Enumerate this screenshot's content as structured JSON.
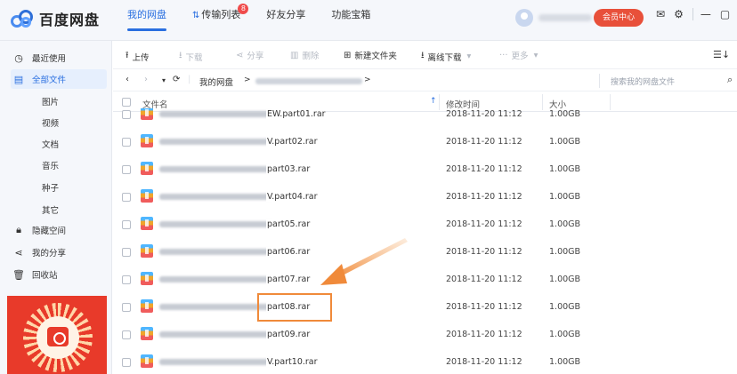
{
  "app": {
    "name": "百度网盘"
  },
  "topnav": {
    "items": [
      {
        "label": "我的网盘",
        "active": true
      },
      {
        "label": "传输列表",
        "badge": "8"
      },
      {
        "label": "好友分享"
      },
      {
        "label": "功能宝箱"
      }
    ]
  },
  "user": {
    "vip_label": "会员中心"
  },
  "sidebar": {
    "items": [
      {
        "label": "最近使用",
        "icon": "clock-icon"
      },
      {
        "label": "全部文件",
        "icon": "file-icon",
        "active": true
      }
    ],
    "subitems": [
      "图片",
      "视频",
      "文档",
      "音乐",
      "种子",
      "其它"
    ],
    "items2": [
      {
        "label": "隐藏空间",
        "icon": "lock-icon"
      },
      {
        "label": "我的分享",
        "icon": "share-icon"
      },
      {
        "label": "回收站",
        "icon": "trash-icon"
      }
    ]
  },
  "toolbar": {
    "upload": "上传",
    "download": "下载",
    "share": "分享",
    "delete": "删除",
    "new_folder": "新建文件夹",
    "offline": "离线下载",
    "more": "更多"
  },
  "breadcrumb": {
    "root": "我的网盘",
    "sep": ">",
    "search_placeholder": "搜索我的网盘文件"
  },
  "columns": {
    "name": "文件名",
    "modified": "修改时间",
    "size": "大小"
  },
  "files": [
    {
      "suffix": "EW.part01.rar",
      "date": "2018-11-20 11:12",
      "size": "1.00GB"
    },
    {
      "suffix": "V.part02.rar",
      "date": "2018-11-20 11:12",
      "size": "1.00GB"
    },
    {
      "suffix": "part03.rar",
      "date": "2018-11-20 11:12",
      "size": "1.00GB"
    },
    {
      "suffix": "V.part04.rar",
      "date": "2018-11-20 11:12",
      "size": "1.00GB"
    },
    {
      "suffix": "part05.rar",
      "date": "2018-11-20 11:12",
      "size": "1.00GB"
    },
    {
      "suffix": "part06.rar",
      "date": "2018-11-20 11:12",
      "size": "1.00GB"
    },
    {
      "suffix": "part07.rar",
      "date": "2018-11-20 11:12",
      "size": "1.00GB"
    },
    {
      "suffix": "part08.rar",
      "date": "2018-11-20 11:12",
      "size": "1.00GB",
      "highlighted": true
    },
    {
      "suffix": "part09.rar",
      "date": "2018-11-20 11:12",
      "size": "1.00GB"
    },
    {
      "suffix": "V.part10.rar",
      "date": "2018-11-20 11:12",
      "size": "1.00GB"
    }
  ],
  "colors": {
    "accent": "#2a6fe0",
    "vip": "#e8503a",
    "annotation": "#f08a3a"
  }
}
